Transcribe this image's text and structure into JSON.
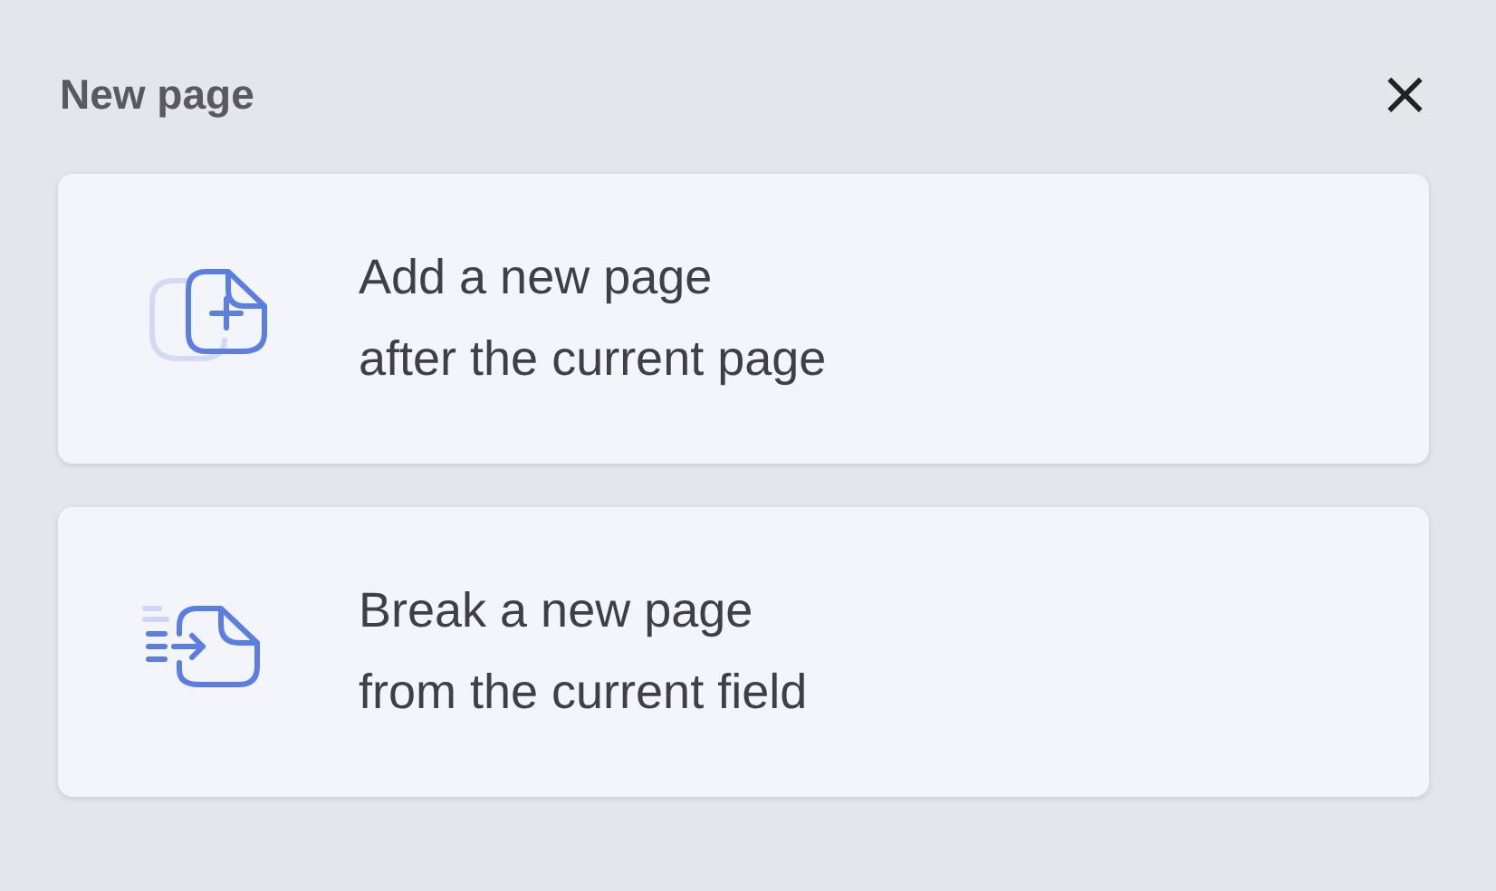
{
  "title": "New page",
  "close": "×",
  "options": [
    {
      "kind": "add",
      "lines": [
        "Add a new page",
        "after the current page"
      ]
    },
    {
      "kind": "break",
      "lines": [
        "Break a new page",
        "from the current field"
      ]
    }
  ]
}
